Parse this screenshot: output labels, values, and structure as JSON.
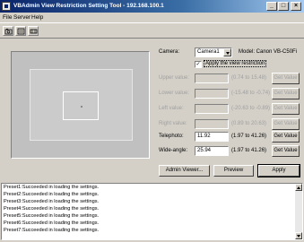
{
  "window": {
    "title": "VBAdmin View Restriction Setting Tool - 192.168.100.1",
    "minimize_glyph": "_",
    "maximize_glyph": "□",
    "close_glyph": "×"
  },
  "menu": {
    "file": "File",
    "server": "Server",
    "help": "Help"
  },
  "toolbar": {
    "icons": [
      "camera-icon",
      "view-icon",
      "settings-icon"
    ]
  },
  "camera": {
    "label": "Camera:",
    "selected": "Camera1",
    "model_text": "Model: Canon VB-C50Fi"
  },
  "apply_restriction": {
    "label": "Apply the view restriction",
    "checked": true,
    "check_glyph": "✓"
  },
  "fields": [
    {
      "label": "Upper value:",
      "value": "",
      "range": "(0.74 to 15.48)",
      "button": "Get Value",
      "enabled": false
    },
    {
      "label": "Lower value:",
      "value": "",
      "range": "(-15.48 to -0.74)",
      "button": "Get Value",
      "enabled": false
    },
    {
      "label": "Left value:",
      "value": "",
      "range": "(-20.63 to -0.89)",
      "button": "Get Value",
      "enabled": false
    },
    {
      "label": "Right value:",
      "value": "",
      "range": "(0.89 to 20.63)",
      "button": "Get Value",
      "enabled": false
    },
    {
      "label": "Telephoto:",
      "value": "11.92",
      "range": "(1.97 to 41.26)",
      "button": "Get Value",
      "enabled": true
    },
    {
      "label": "Wide-angle:",
      "value": "25.94",
      "range": "(1.97 to 41.26)",
      "button": "Get Value",
      "enabled": true
    }
  ],
  "buttons": {
    "admin_viewer": "Admin Viewer...",
    "preview": "Preview",
    "apply": "Apply"
  },
  "log": {
    "lines": [
      "Preset1:Succeeded in loading the settings.",
      "Preset2:Succeeded in loading the settings.",
      "Preset3:Succeeded in loading the settings.",
      "Preset4:Succeeded in loading the settings.",
      "Preset5:Succeeded in loading the settings.",
      "Preset6:Succeeded in loading the settings.",
      "Preset7:Succeeded in loading the settings."
    ]
  },
  "colors": {
    "titlebar": "#0a246a",
    "face": "#d4d0c8",
    "disabled_text": "#a0a0a0"
  }
}
